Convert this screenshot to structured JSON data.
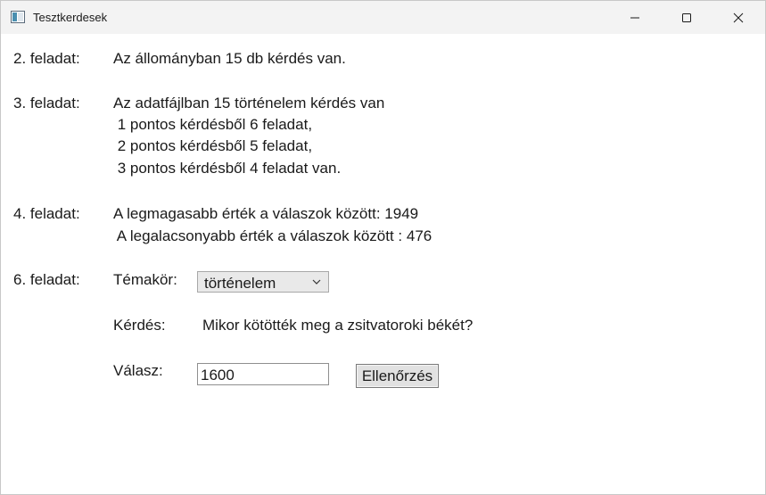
{
  "window": {
    "title": "Tesztkerdesek",
    "controls": {
      "minimize_icon": "minimize-icon",
      "maximize_icon": "maximize-icon",
      "close_icon": "close-icon"
    }
  },
  "task2": {
    "label": "2. feladat:",
    "text": "Az állományban 15 db kérdés van."
  },
  "task3": {
    "label": "3. feladat:",
    "lines": [
      "Az adatfájlban 15 történelem kérdés van",
      " 1 pontos kérdésből 6 feladat,",
      " 2 pontos kérdésből 5 feladat,",
      " 3 pontos kérdésből 4 feladat van."
    ]
  },
  "task4": {
    "label": "4. feladat:",
    "lines": [
      "A legmagasabb érték a válaszok között: 1949",
      " A legalacsonyabb érték a válaszok között : 476"
    ]
  },
  "task6": {
    "label": "6. feladat:",
    "topic_label": "Témakör:",
    "topic_value": "történelem",
    "question_label": "Kérdés:",
    "question_text": "Mikor kötötték meg a zsitvatoroki békét?",
    "answer_label": "Válasz:",
    "answer_value": "1600",
    "check_button": "Ellenőrzés"
  }
}
